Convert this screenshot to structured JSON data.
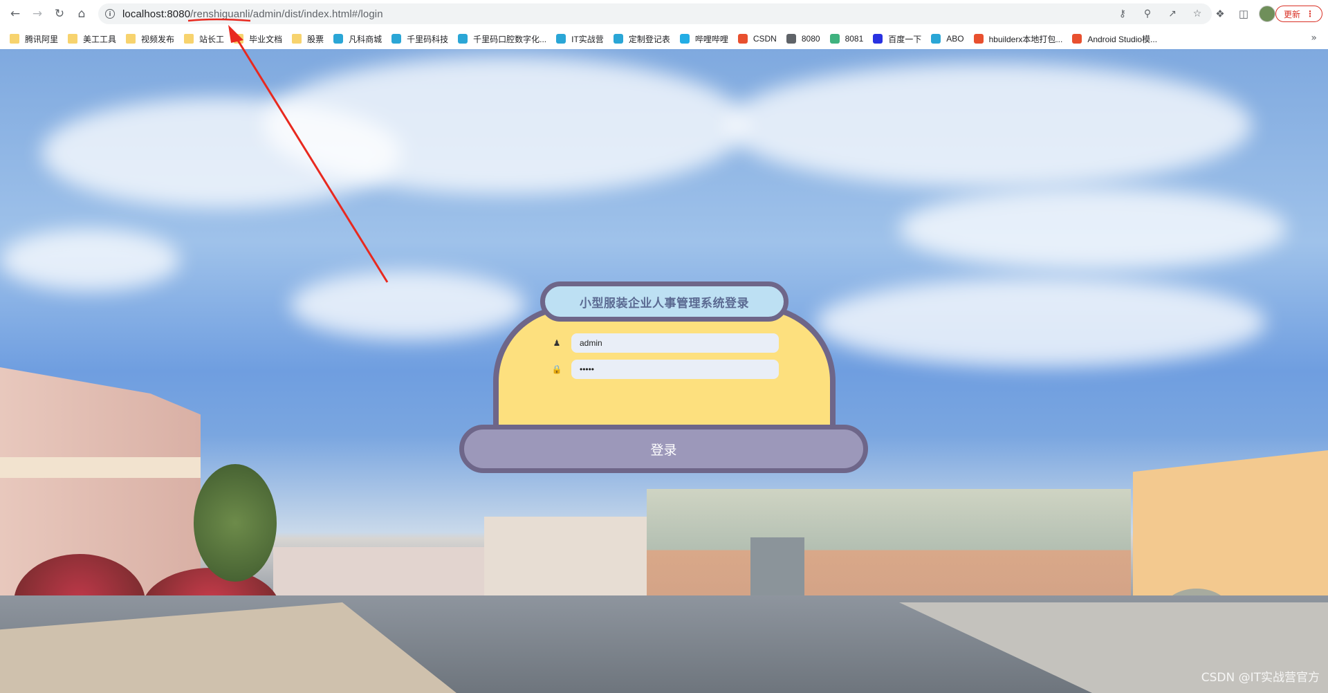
{
  "browser": {
    "url_host": "localhost:8080",
    "url_path": "/renshiguanli/admin/dist/index.html#/login",
    "update_label": "更新",
    "bookmarks": [
      {
        "label": "腾讯阿里",
        "icon": "folder-icon"
      },
      {
        "label": "美工工具",
        "icon": "folder-icon"
      },
      {
        "label": "视频发布",
        "icon": "folder-icon"
      },
      {
        "label": "站长工",
        "icon": "folder-icon"
      },
      {
        "label": "毕业文档",
        "icon": "folder-icon"
      },
      {
        "label": "股票",
        "icon": "folder-icon"
      },
      {
        "label": "凡科商城",
        "icon": "site-icon"
      },
      {
        "label": "千里码科技",
        "icon": "site-icon"
      },
      {
        "label": "千里码口腔数字化...",
        "icon": "site-icon"
      },
      {
        "label": "IT实战营",
        "icon": "site-icon"
      },
      {
        "label": "定制登记表",
        "icon": "site-icon"
      },
      {
        "label": "哔哩哔哩",
        "icon": "bilibili-icon"
      },
      {
        "label": "CSDN",
        "icon": "csdn-icon"
      },
      {
        "label": "8080",
        "icon": "globe-icon"
      },
      {
        "label": "8081",
        "icon": "vue-icon"
      },
      {
        "label": "百度一下",
        "icon": "baidu-icon"
      },
      {
        "label": "ABO",
        "icon": "site-icon"
      },
      {
        "label": "hbuilderx本地打包...",
        "icon": "csdn-icon"
      },
      {
        "label": "Android Studio模...",
        "icon": "csdn-icon"
      }
    ],
    "more_label": "»"
  },
  "login": {
    "title": "小型服装企业人事管理系统登录",
    "username_value": "admin",
    "password_value": "•••••",
    "submit_label": "登录"
  },
  "watermark": "CSDN @IT实战营官方",
  "colors": {
    "card_fill": "#fde07e",
    "card_border": "#6e6689",
    "title_fill": "#bde0f3",
    "button_fill": "#9c98ba",
    "arrow": "#e8291f"
  }
}
